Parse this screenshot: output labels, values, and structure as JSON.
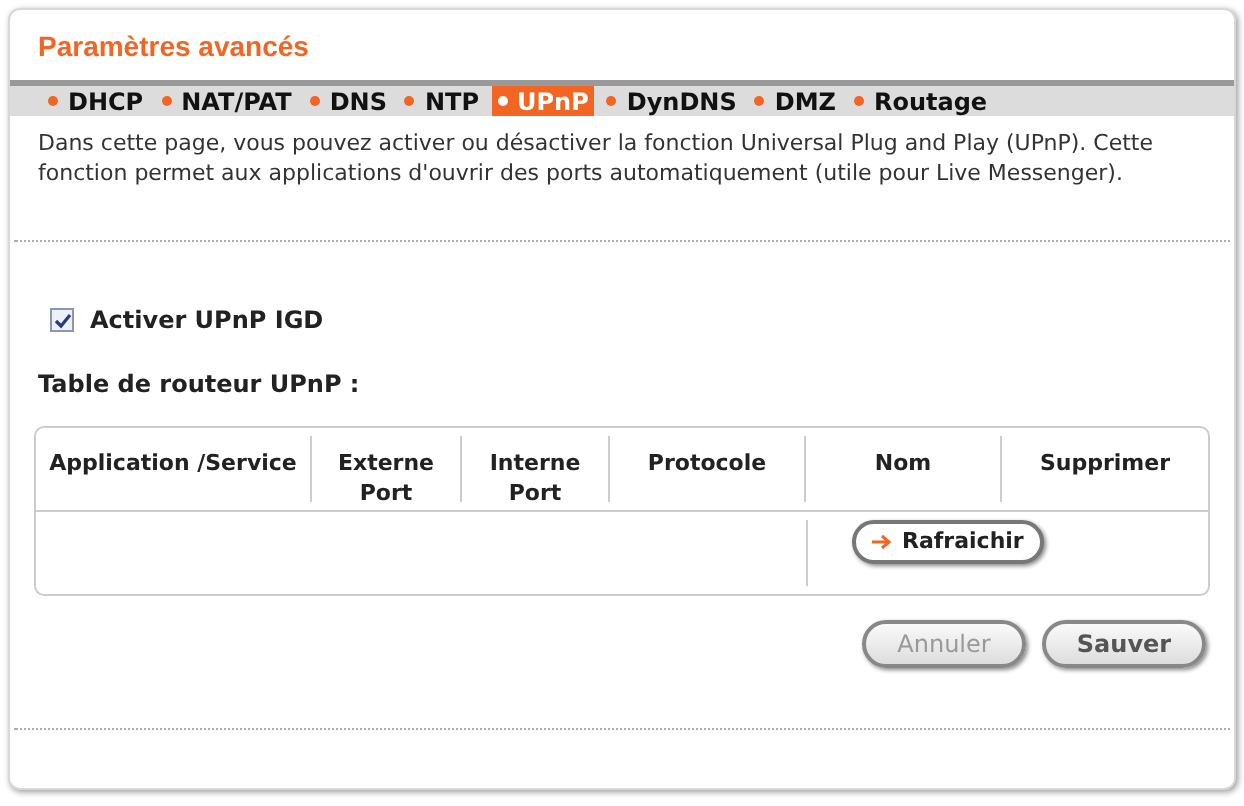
{
  "title": "Paramètres avancés",
  "tabs": [
    {
      "label": "DHCP",
      "selected": false
    },
    {
      "label": "NAT/PAT",
      "selected": false
    },
    {
      "label": "DNS",
      "selected": false
    },
    {
      "label": "NTP",
      "selected": false
    },
    {
      "label": "UPnP",
      "selected": true
    },
    {
      "label": "DynDNS",
      "selected": false
    },
    {
      "label": "DMZ",
      "selected": false
    },
    {
      "label": "Routage",
      "selected": false
    }
  ],
  "description": "Dans cette page, vous pouvez activer ou désactiver la fonction Universal Plug and Play (UPnP). Cette fonction permet aux applications d'ouvrir des ports automatiquement (utile pour Live Messenger).",
  "enable": {
    "label": "Activer UPnP IGD",
    "checked": true
  },
  "table": {
    "title": "Table de routeur UPnP :",
    "columns": [
      "Application /Service",
      "Externe Port",
      "Interne Port",
      "Protocole",
      "Nom",
      "Supprimer"
    ],
    "refresh_button": "Rafraichir"
  },
  "buttons": [
    {
      "label": "Annuler",
      "disabled": true
    },
    {
      "label": "Sauver",
      "disabled": false
    }
  ]
}
